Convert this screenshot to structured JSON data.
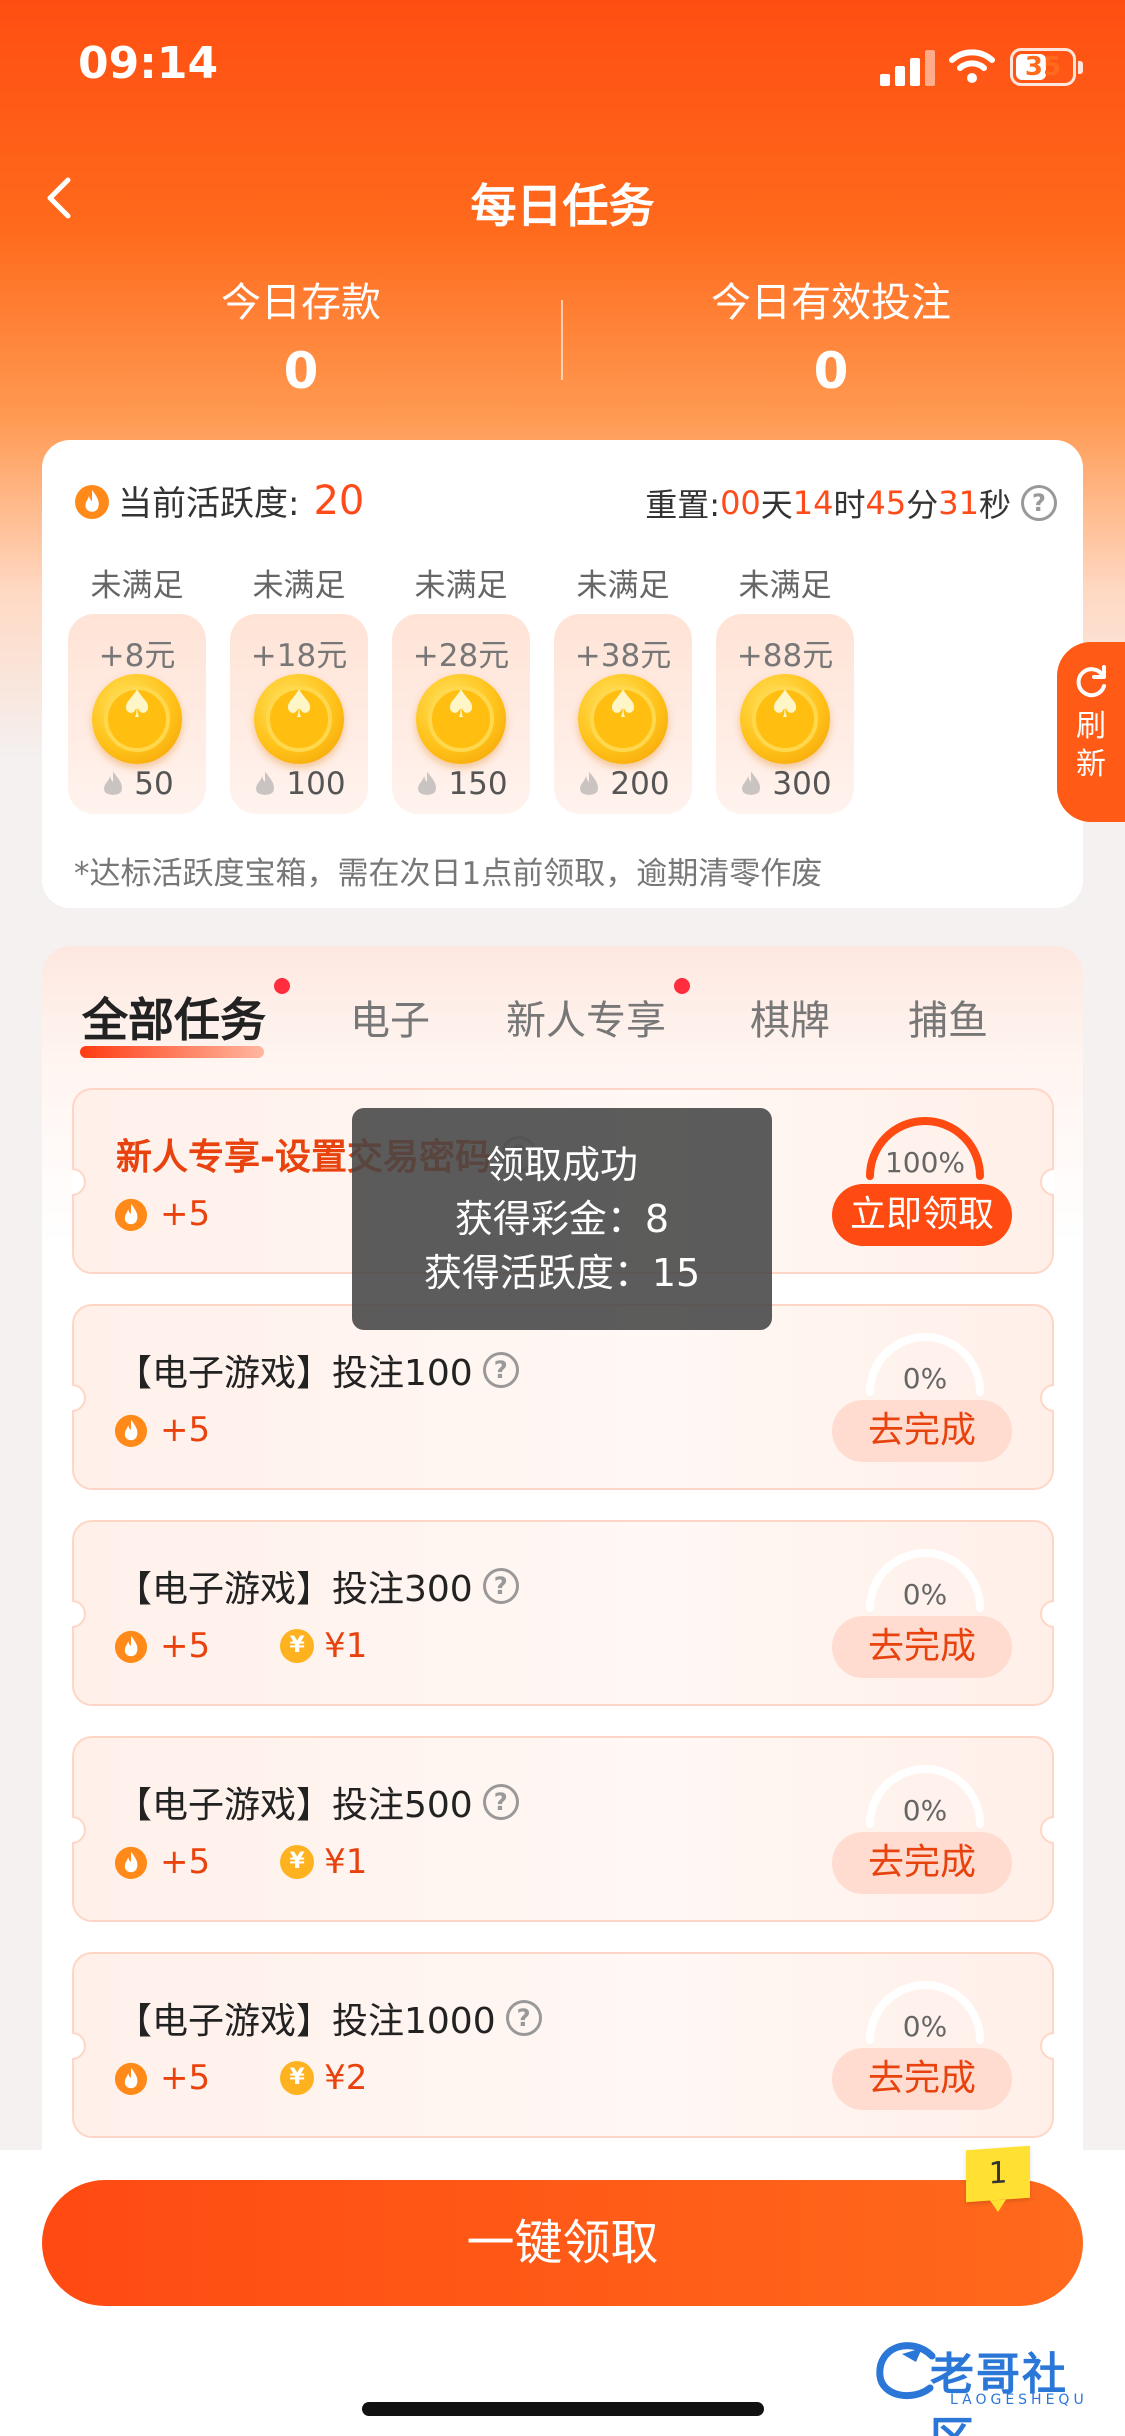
{
  "status_bar": {
    "time": "09:14",
    "battery": "35"
  },
  "nav": {
    "title": "每日任务"
  },
  "stats": [
    {
      "label": "今日存款",
      "value": "0"
    },
    {
      "label": "今日有效投注",
      "value": "0"
    }
  ],
  "activity": {
    "label": "当前活跃度:",
    "score": "20",
    "reset": {
      "prefix": "重置:",
      "d": "00",
      "d_unit": "天",
      "h": "14",
      "h_unit": "时",
      "m": "45",
      "m_unit": "分",
      "s": "31",
      "s_unit": "秒"
    },
    "rewards": [
      {
        "status": "未满足",
        "amount": "+8元",
        "need": "50"
      },
      {
        "status": "未满足",
        "amount": "+18元",
        "need": "100"
      },
      {
        "status": "未满足",
        "amount": "+28元",
        "need": "150"
      },
      {
        "status": "未满足",
        "amount": "+38元",
        "need": "200"
      },
      {
        "status": "未满足",
        "amount": "+88元",
        "need": "300"
      }
    ],
    "note": "*达标活跃度宝箱，需在次日1点前领取，逾期清零作废"
  },
  "refresh": {
    "line1": "刷",
    "line2": "新"
  },
  "tabs": [
    "全部任务",
    "电子",
    "新人专享",
    "棋牌",
    "捕鱼"
  ],
  "tasks": [
    {
      "title": "新人专享-设置交易密码",
      "activity": "+5",
      "money": "",
      "percent": "100%",
      "button": "立即领取"
    },
    {
      "title": "【电子游戏】投注100",
      "activity": "+5",
      "money": "",
      "percent": "0%",
      "button": "去完成"
    },
    {
      "title": "【电子游戏】投注300",
      "activity": "+5",
      "money": "¥1",
      "percent": "0%",
      "button": "去完成"
    },
    {
      "title": "【电子游戏】投注500",
      "activity": "+5",
      "money": "¥1",
      "percent": "0%",
      "button": "去完成"
    },
    {
      "title": "【电子游戏】投注1000",
      "activity": "+5",
      "money": "¥2",
      "percent": "0%",
      "button": "去完成"
    }
  ],
  "toast": {
    "line1": "领取成功",
    "line2": "获得彩金：8",
    "line3": "获得活跃度：15"
  },
  "bottom": {
    "claim_all": "一键领取",
    "badge": "1"
  },
  "watermark": {
    "main": "老哥社区",
    "sub": "LAOGESHEQU"
  },
  "colors": {
    "brand": "#ff4a12",
    "accent": "#e8430e"
  }
}
